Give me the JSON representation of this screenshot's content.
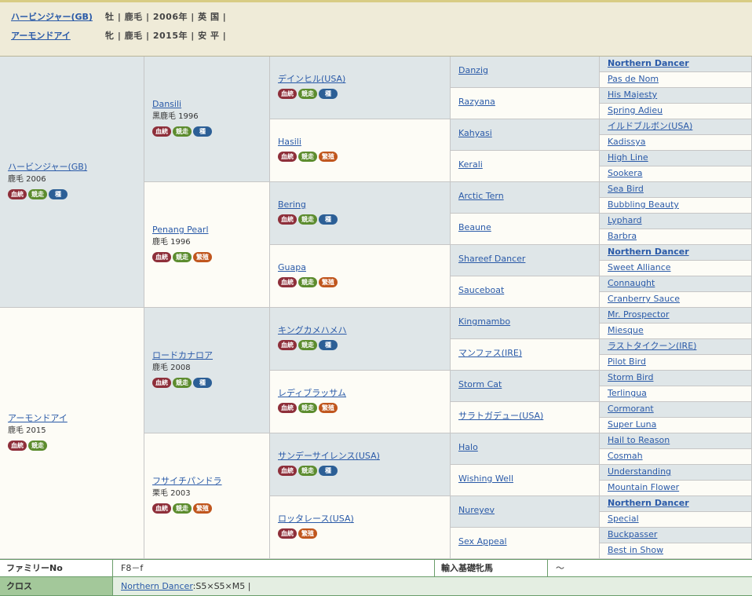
{
  "header": {
    "horse1": {
      "name": "ハービンジャー(GB)",
      "info": "牡 | 鹿毛 | 2006年 | 英 国 |"
    },
    "horse2": {
      "name": "アーモンドアイ",
      "info": "牝 | 鹿毛 | 2015年 | 安 平 |"
    }
  },
  "badge_labels": {
    "blood": "血統",
    "race": "競走",
    "sire": "種",
    "breed": "繁殖"
  },
  "colors": {
    "sire_line_bg": "#dfe6e8",
    "dam_line_bg": "#fdfcf6",
    "header_bg": "#efebd8",
    "link": "#2a5aa8",
    "footer_label_bg": "#a3c89a"
  },
  "pedigree": {
    "g1": [
      {
        "name": "ハービンジャー(GB)",
        "detail": "鹿毛 2006",
        "badges": [
          "blood",
          "race",
          "sire"
        ]
      },
      {
        "name": "アーモンドアイ",
        "detail": "鹿毛 2015",
        "badges": [
          "blood",
          "race"
        ]
      }
    ],
    "g2": [
      {
        "name": "Dansili",
        "detail": "黒鹿毛 1996",
        "badges": [
          "blood",
          "race",
          "sire"
        ]
      },
      {
        "name": "Penang Pearl",
        "detail": "鹿毛 1996",
        "badges": [
          "blood",
          "race",
          "breed"
        ]
      },
      {
        "name": "ロードカナロア",
        "detail": "鹿毛 2008",
        "badges": [
          "blood",
          "race",
          "sire"
        ]
      },
      {
        "name": "フサイチパンドラ",
        "detail": "栗毛 2003",
        "badges": [
          "blood",
          "race",
          "breed"
        ]
      }
    ],
    "g3": [
      {
        "name": "デインヒル(USA)",
        "badges": [
          "blood",
          "race",
          "sire"
        ]
      },
      {
        "name": "Hasili",
        "badges": [
          "blood",
          "race",
          "breed"
        ]
      },
      {
        "name": "Bering",
        "badges": [
          "blood",
          "race",
          "sire"
        ]
      },
      {
        "name": "Guapa",
        "badges": [
          "blood",
          "race",
          "breed"
        ]
      },
      {
        "name": "キングカメハメハ",
        "badges": [
          "blood",
          "race",
          "sire"
        ]
      },
      {
        "name": "レディブラッサム",
        "badges": [
          "blood",
          "race",
          "breed"
        ]
      },
      {
        "name": "サンデーサイレンス(USA)",
        "badges": [
          "blood",
          "race",
          "sire"
        ]
      },
      {
        "name": "ロッタレース(USA)",
        "badges": [
          "blood",
          "breed"
        ]
      }
    ],
    "g4": [
      "Danzig",
      "Razyana",
      "Kahyasi",
      "Kerali",
      "Arctic Tern",
      "Beaune",
      "Shareef Dancer",
      "Sauceboat",
      "Kingmambo",
      "マンファス(IRE)",
      "Storm Cat",
      "サラトガデュー(USA)",
      "Halo",
      "Wishing Well",
      "Nureyev",
      "Sex Appeal"
    ],
    "g5": [
      {
        "name": "Northern Dancer",
        "bold": true
      },
      {
        "name": "Pas de Nom"
      },
      {
        "name": "His Majesty"
      },
      {
        "name": "Spring Adieu"
      },
      {
        "name": "イルドブルボン(USA)"
      },
      {
        "name": "Kadissya"
      },
      {
        "name": "High Line"
      },
      {
        "name": "Sookera"
      },
      {
        "name": "Sea Bird"
      },
      {
        "name": "Bubbling Beauty"
      },
      {
        "name": "Lyphard"
      },
      {
        "name": "Barbra"
      },
      {
        "name": "Northern Dancer",
        "bold": true
      },
      {
        "name": "Sweet Alliance"
      },
      {
        "name": "Connaught"
      },
      {
        "name": "Cranberry Sauce"
      },
      {
        "name": "Mr. Prospector"
      },
      {
        "name": "Miesque"
      },
      {
        "name": "ラストタイクーン(IRE)"
      },
      {
        "name": "Pilot Bird"
      },
      {
        "name": "Storm Bird"
      },
      {
        "name": "Terlingua"
      },
      {
        "name": "Cormorant"
      },
      {
        "name": "Super Luna"
      },
      {
        "name": "Hail to Reason"
      },
      {
        "name": "Cosmah"
      },
      {
        "name": "Understanding"
      },
      {
        "name": "Mountain Flower"
      },
      {
        "name": "Northern Dancer",
        "bold": true
      },
      {
        "name": "Special"
      },
      {
        "name": "Buckpasser"
      },
      {
        "name": "Best in Show"
      }
    ]
  },
  "footer": {
    "family_label": "ファミリーNo",
    "family_value": "F8－f",
    "import_label": "輸入基礎牝馬",
    "import_value": "～",
    "cross_label": "クロス",
    "cross_link": "Northern Dancer",
    "cross_value": ":S5×S5×M5 |"
  }
}
